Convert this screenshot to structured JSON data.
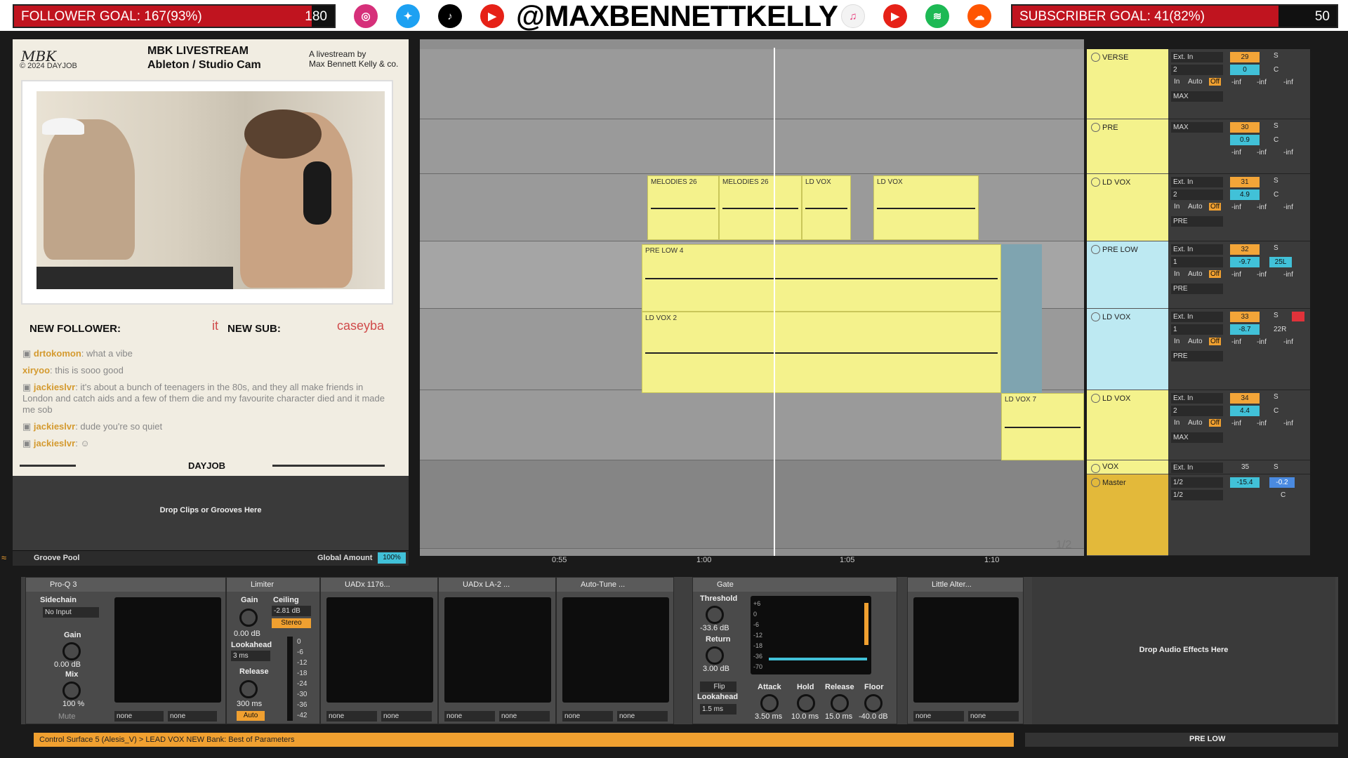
{
  "banner": {
    "follower_goal_label": "FOLLOWER GOAL:",
    "follower_goal_value": "167(93%)",
    "follower_goal_target": "180",
    "follower_goal_progress": 0.93,
    "handle": "@MAXBENNETTKELLY",
    "subscriber_goal_label": "SUBSCRIBER GOAL:",
    "subscriber_goal_value": "41(82%)",
    "subscriber_goal_target": "50",
    "subscriber_goal_progress": 0.82,
    "accent_red": "#c0141f",
    "social_icons": [
      "instagram-icon",
      "twitter-icon",
      "tiktok-icon",
      "youtube-icon",
      "apple-music-icon",
      "youtube-music-icon",
      "spotify-icon",
      "soundcloud-icon"
    ]
  },
  "stream": {
    "logo": "MBK",
    "copyright": "© 2024 DAYJOB",
    "title": "MBK LIVESTREAM",
    "subtitle": "Ableton / Studio Cam",
    "byline_1": "A livestream by",
    "byline_2": "Max Bennett Kelly & co.",
    "new_follower_label": "NEW FOLLOWER:",
    "new_follower_value": "it",
    "new_sub_label": "NEW SUB:",
    "new_sub_value": "caseyba",
    "footer_logo": "DAYJOB",
    "chat": [
      {
        "user": "drtokomon",
        "text": "what a vibe"
      },
      {
        "user": "xiryoo",
        "text": "this is sooo good"
      },
      {
        "user": "jackieslvr",
        "text": "it's about a bunch of teenagers in the 80s, and they all make friends in London and catch aids and a few of them die and my favourite character died and it made me sob"
      },
      {
        "user": "jackieslvr",
        "text": "dude you're so quiet"
      },
      {
        "user": "jackieslvr",
        "text": ""
      }
    ]
  },
  "groove": {
    "drop_text": "Drop Clips or Grooves Here",
    "pool_label": "Groove Pool",
    "global_amount_label": "Global Amount",
    "global_amount_value": "100%"
  },
  "arrangement": {
    "clips": [
      "MELODIES 26",
      "MELODIES 26",
      "LD VOX",
      "LD VOX",
      "PRE LOW 4",
      "LD VOX 2",
      "LD VOX 7"
    ],
    "times": [
      "0:55",
      "1:00",
      "1:05",
      "1:10"
    ],
    "page_label": "1/2",
    "clip_color": "#f4f28c"
  },
  "tracks": [
    {
      "name": "VERSE",
      "input": "Ext. In",
      "channel": "2",
      "monitor": "MAX",
      "num": "29",
      "vol": "0",
      "pan": "C",
      "auto": "Auto",
      "off": "Off",
      "in": "In"
    },
    {
      "name": "PRE",
      "input": "MAX",
      "channel": "",
      "monitor": "",
      "num": "30",
      "vol": "0.9",
      "pan": "C"
    },
    {
      "name": "LD VOX",
      "input": "Ext. In",
      "channel": "2",
      "monitor": "PRE",
      "num": "31",
      "vol": "4.9",
      "pan": "C",
      "auto": "Auto",
      "off": "Off",
      "in": "In"
    },
    {
      "name": "PRE LOW",
      "input": "Ext. In",
      "channel": "1",
      "monitor": "PRE",
      "num": "32",
      "vol": "-9.7",
      "pan": "25L",
      "auto": "Auto",
      "off": "Off",
      "in": "In"
    },
    {
      "name": "LD VOX",
      "input": "Ext. In",
      "channel": "1",
      "monitor": "PRE",
      "num": "33",
      "vol": "-8.7",
      "pan": "22R",
      "auto": "Auto",
      "off": "Off",
      "in": "In"
    },
    {
      "name": "LD VOX",
      "input": "Ext. In",
      "channel": "2",
      "monitor": "MAX",
      "num": "34",
      "vol": "4.4",
      "pan": "C",
      "auto": "Auto",
      "off": "Off",
      "in": "In"
    },
    {
      "name": "VOX",
      "input": "Ext. In",
      "channel": "",
      "monitor": "",
      "num": "35",
      "vol": "",
      "pan": ""
    },
    {
      "name": "Master",
      "input": "1/2",
      "channel": "1/2",
      "monitor": "",
      "num": "",
      "vol": "-15.4",
      "pan": "C",
      "extra": "-0.2"
    }
  ],
  "inf": "-inf",
  "solo": "S",
  "devices": {
    "proq": {
      "title": "Pro-Q 3"
    },
    "compressor": {
      "sidechain": "Sidechain",
      "input": "No Input",
      "gain_label": "Gain",
      "gain": "0.00 dB",
      "mix_label": "Mix",
      "mix": "100 %",
      "mute": "Mute",
      "none": "none"
    },
    "limiter": {
      "title": "Limiter",
      "gain_label": "Gain",
      "gain": "0.00 dB",
      "ceiling_label": "Ceiling",
      "ceiling": "-2.81 dB",
      "stereo": "Stereo",
      "lookahead_label": "Lookahead",
      "lookahead": "3 ms",
      "release_label": "Release",
      "release": "300 ms",
      "auto": "Auto",
      "scale": [
        "0",
        "-6",
        "-12",
        "-18",
        "-24",
        "-30",
        "-36",
        "-42"
      ]
    },
    "uad1176": {
      "title": "UADx 1176..."
    },
    "uadla2": {
      "title": "UADx LA-2 ..."
    },
    "autotune": {
      "title": "Auto-Tune ..."
    },
    "gate": {
      "title": "Gate",
      "threshold_label": "Threshold",
      "threshold": "-33.6 dB",
      "return_label": "Return",
      "return": "3.00 dB",
      "flip": "Flip",
      "lookahead_label": "Lookahead",
      "lookahead": "1.5 ms",
      "attack_label": "Attack",
      "attack": "3.50 ms",
      "hold_label": "Hold",
      "hold": "10.0 ms",
      "release_label": "Release",
      "release": "15.0 ms",
      "floor_label": "Floor",
      "floor": "-40.0 dB",
      "scale": [
        "+6",
        "0",
        "-6",
        "-12",
        "-18",
        "-36",
        "-70"
      ]
    },
    "alter": {
      "title": "Little Alter..."
    },
    "drop_text": "Drop Audio Effects Here",
    "none": "none"
  },
  "status": {
    "text": "Control Surface 5 (Alesis_V) > LEAD VOX NEW Bank: Best of Parameters",
    "track": "PRE LOW"
  }
}
